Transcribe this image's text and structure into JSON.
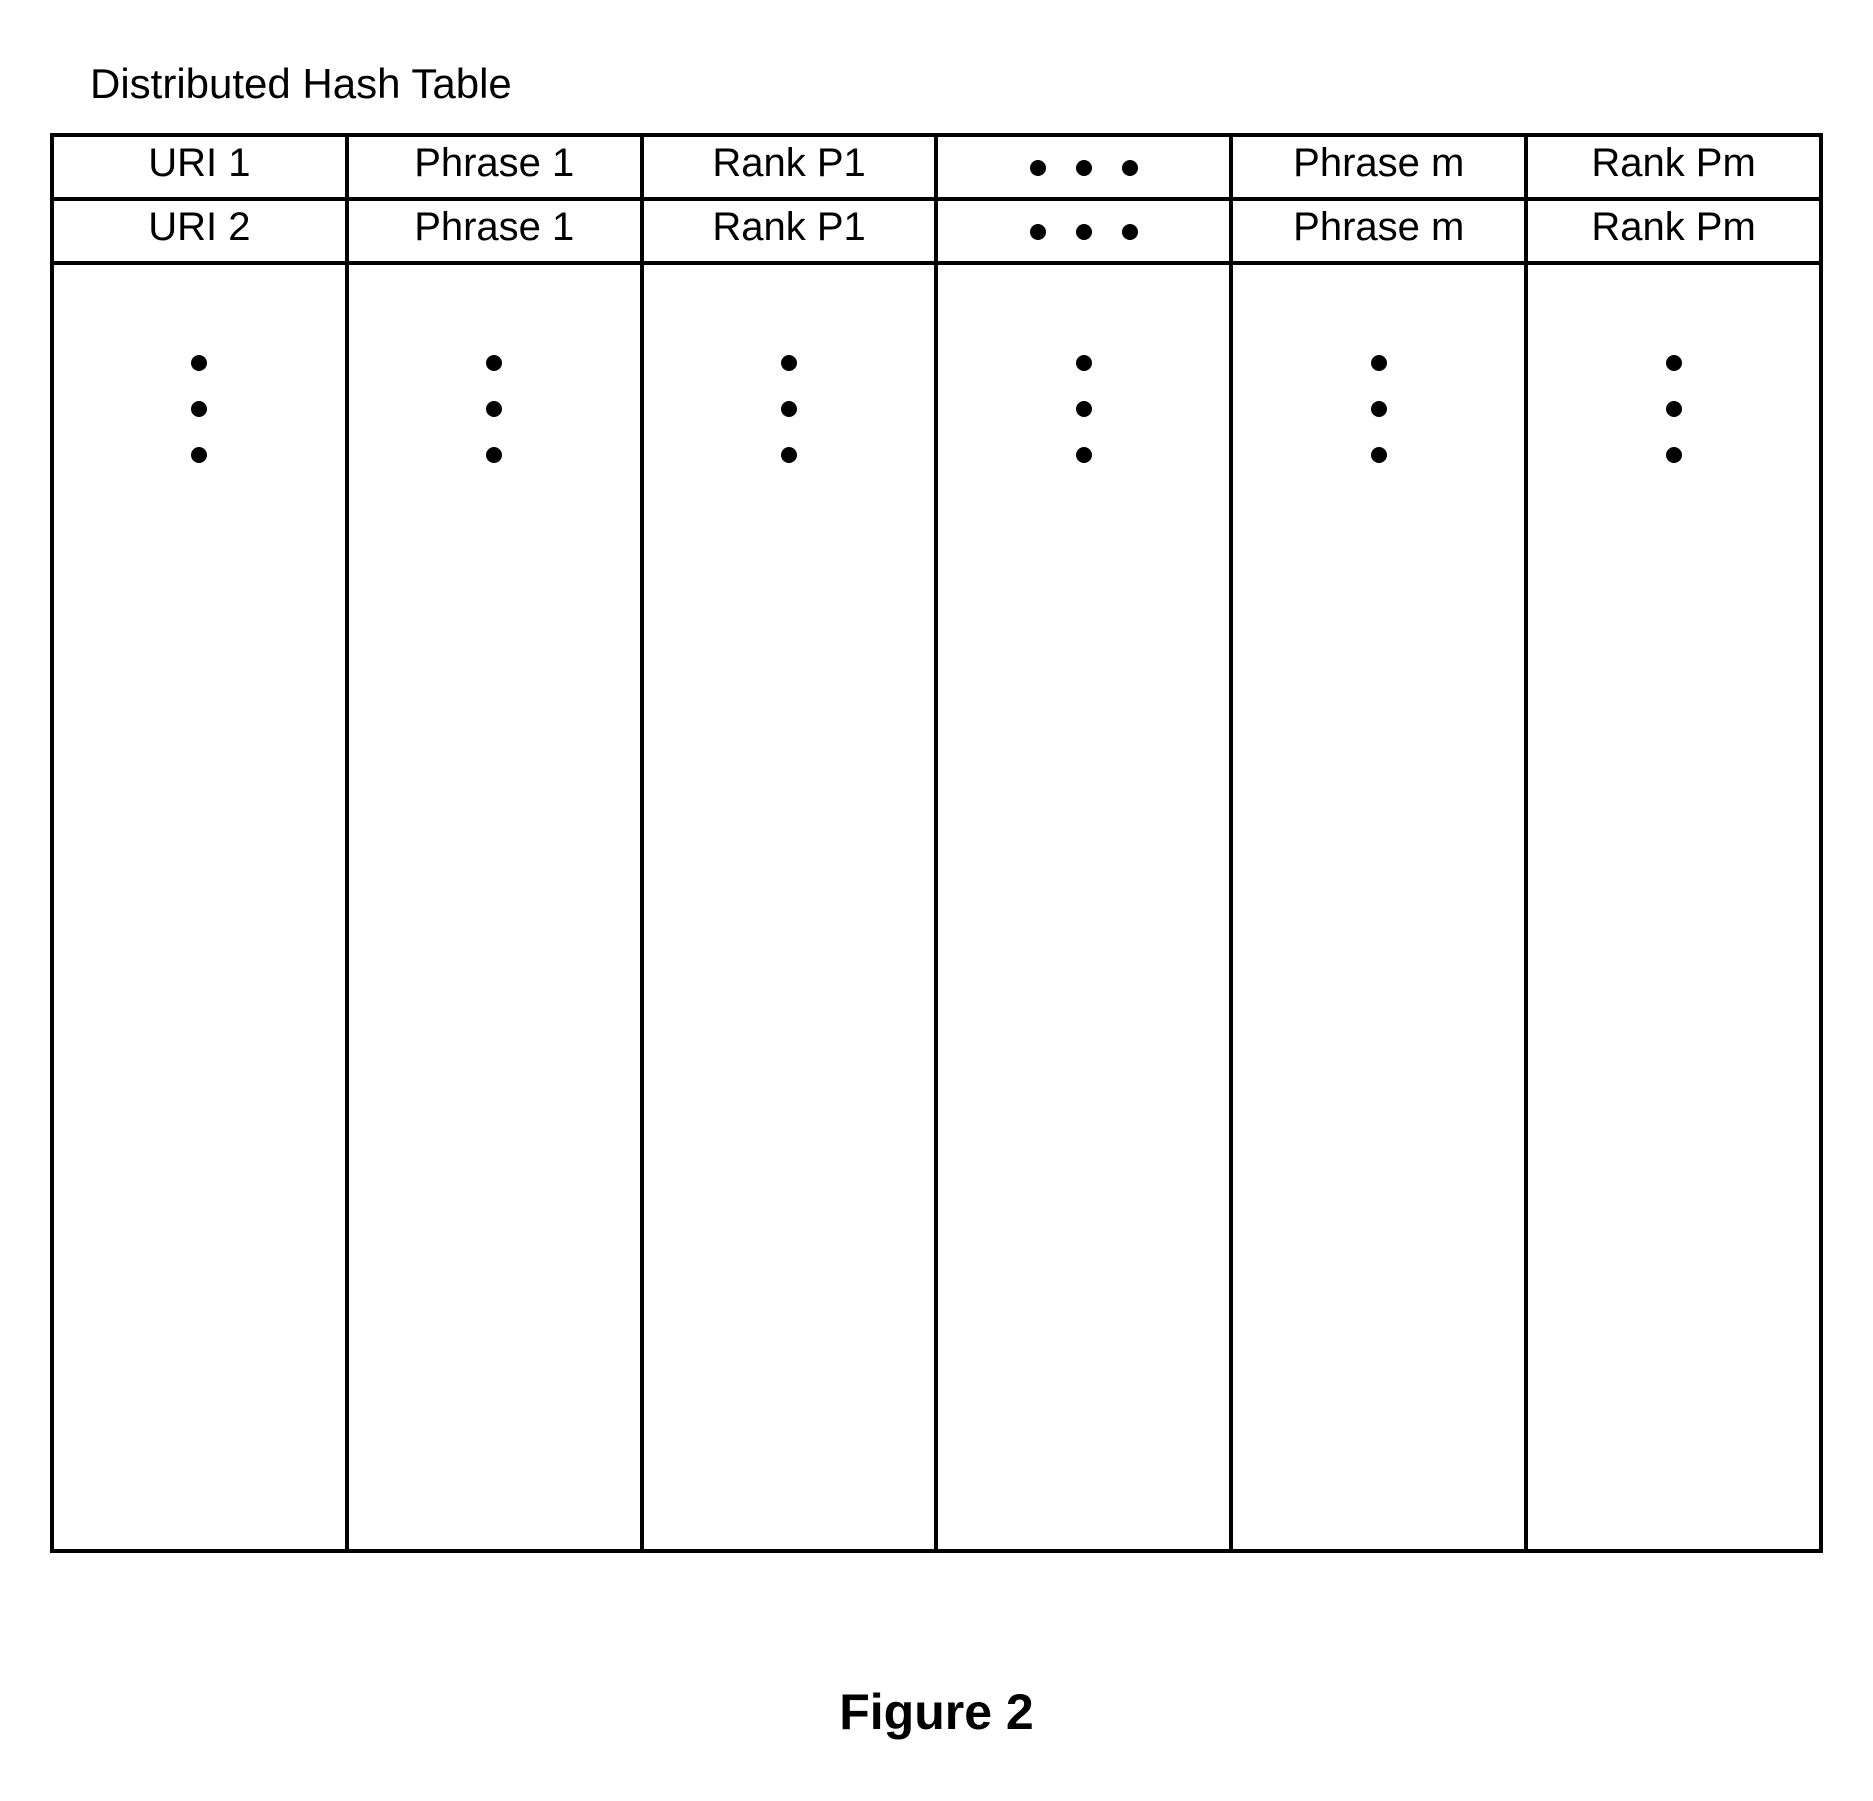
{
  "title": "Distributed Hash Table",
  "caption": "Figure 2",
  "table": {
    "rows": [
      {
        "cells": [
          "URI 1",
          "Phrase 1",
          "Rank P1",
          "...",
          "Phrase m",
          "Rank Pm"
        ]
      },
      {
        "cells": [
          "URI 2",
          "Phrase 1",
          "Rank P1",
          "...",
          "Phrase m",
          "Rank Pm"
        ]
      }
    ],
    "body_ellipsis": true,
    "columns": 6
  }
}
